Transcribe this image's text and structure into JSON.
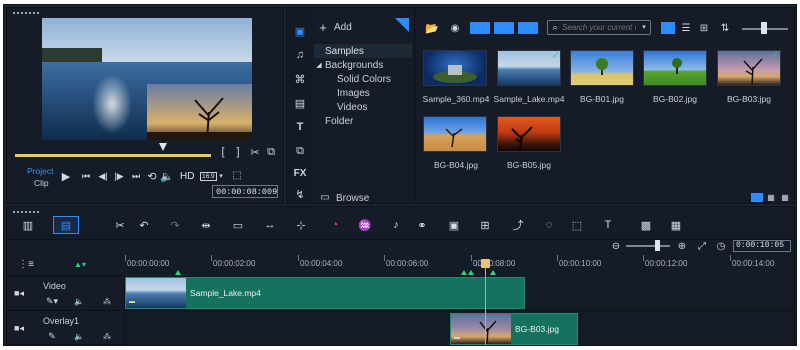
{
  "player": {
    "project_label": "Project",
    "clip_label": "Clip",
    "hd_label": "HD",
    "aspect_label": "16:9",
    "timecode": "00:00:08:009"
  },
  "library": {
    "add_label": "Add",
    "search_placeholder": "Search your current v",
    "browse_label": "Browse",
    "tree": [
      "Samples",
      "Backgrounds",
      "Solid Colors",
      "Images",
      "Videos",
      "Folder"
    ],
    "thumbs": [
      {
        "name": "Sample_360.mp4"
      },
      {
        "name": "Sample_Lake.mp4"
      },
      {
        "name": "BG-B01.jpg"
      },
      {
        "name": "BG-B02.jpg"
      },
      {
        "name": "BG-B03.jpg"
      },
      {
        "name": "BG-B04.jpg"
      },
      {
        "name": "BG-B05.jpg"
      }
    ]
  },
  "timeline": {
    "zoom_timecode": "0:00:10:05",
    "ruler": [
      "00:00:00:00",
      "00:00:02:00",
      "00:00:04:00",
      "00:00:06:00",
      "00:00:08:00",
      "00:00:10:00",
      "00:00:12:00",
      "00:00:14:00"
    ],
    "tracks": [
      {
        "name": "Video",
        "clip": "Sample_Lake.mp4"
      },
      {
        "name": "Overlay1",
        "clip": "BG-B03.jpg"
      }
    ]
  },
  "colors": {
    "accent": "#2d8cff",
    "clip": "#15725f",
    "playhead": "#e6c478",
    "background": "#1c2431"
  }
}
